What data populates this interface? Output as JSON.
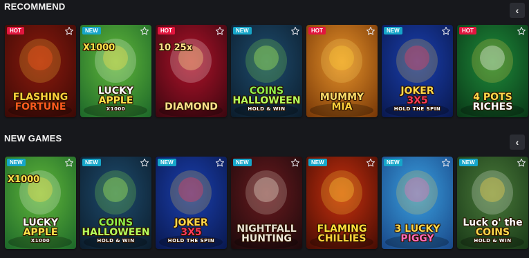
{
  "sections": [
    {
      "title": "RECOMMEND",
      "games": [
        {
          "badge": "HOT",
          "l1": "FLASHING",
          "l2": "FORTUNE",
          "l3": "",
          "extra": "",
          "bg": [
            "#8c1a0d",
            "#3d0a06"
          ],
          "c1": "#ffd23a",
          "c2": "#ff5a1e",
          "subc": "#ffffff"
        },
        {
          "badge": "NEW",
          "l1": "LUCKY",
          "l2": "APPLE",
          "l3": "X1000",
          "extra": "X1000",
          "bg": [
            "#62b83a",
            "#1f6a2a"
          ],
          "c1": "#ffffff",
          "c2": "#ffe24a",
          "subc": "#ffffff"
        },
        {
          "badge": "HOT",
          "l1": "",
          "l2": "DIAMOND",
          "l3": "",
          "extra": "10 25x",
          "bg": [
            "#b0122a",
            "#3e0710"
          ],
          "c1": "#ffffff",
          "c2": "#ffe08a",
          "subc": "#ffffff"
        },
        {
          "badge": "NEW",
          "l1": "COINS",
          "l2": "HALLOWEEN",
          "l3": "HOLD & WIN",
          "extra": "",
          "bg": [
            "#1e4c6e",
            "#0c1e2e"
          ],
          "c1": "#8ff04a",
          "c2": "#b8ff5a",
          "subc": "#ffffff"
        },
        {
          "badge": "HOT",
          "l1": "MUMMY",
          "l2": "MIA",
          "l3": "",
          "extra": "",
          "bg": [
            "#e6922a",
            "#7a3a08"
          ],
          "c1": "#ffde6a",
          "c2": "#ffcf3a",
          "subc": "#ffffff"
        },
        {
          "badge": "NEW",
          "l1": "JOKER",
          "l2": "3X5",
          "l3": "HOLD THE SPIN",
          "extra": "",
          "bg": [
            "#1a3fae",
            "#0a1a52"
          ],
          "c1": "#ffd84a",
          "c2": "#ff3a5a",
          "subc": "#ffffff"
        },
        {
          "badge": "HOT",
          "l1": "4 POTS",
          "l2": "RICHES",
          "l3": "",
          "extra": "",
          "bg": [
            "#1e8a3a",
            "#0a3a18"
          ],
          "c1": "#ffd84a",
          "c2": "#ffffff",
          "subc": "#ffffff"
        }
      ]
    },
    {
      "title": "NEW GAMES",
      "games": [
        {
          "badge": "NEW",
          "l1": "LUCKY",
          "l2": "APPLE",
          "l3": "X1000",
          "extra": "X1000",
          "bg": [
            "#62b83a",
            "#1f6a2a"
          ],
          "c1": "#ffffff",
          "c2": "#ffe24a",
          "subc": "#ffffff"
        },
        {
          "badge": "NEW",
          "l1": "COINS",
          "l2": "HALLOWEEN",
          "l3": "HOLD & WIN",
          "extra": "",
          "bg": [
            "#1e4c6e",
            "#0c1e2e"
          ],
          "c1": "#8ff04a",
          "c2": "#b8ff5a",
          "subc": "#ffffff"
        },
        {
          "badge": "NEW",
          "l1": "JOKER",
          "l2": "3X5",
          "l3": "HOLD THE SPIN",
          "extra": "",
          "bg": [
            "#1a3fae",
            "#0a1a52"
          ],
          "c1": "#ffd84a",
          "c2": "#ff3a5a",
          "subc": "#ffffff"
        },
        {
          "badge": "NEW",
          "l1": "NIGHTFALL",
          "l2": "HUNTING",
          "l3": "",
          "extra": "",
          "bg": [
            "#6a1a1e",
            "#1e0a0c"
          ],
          "c1": "#e8e0d0",
          "c2": "#f0e8d8",
          "subc": "#ffffff"
        },
        {
          "badge": "NEW",
          "l1": "FLAMING",
          "l2": "CHILLIES",
          "l3": "",
          "extra": "",
          "bg": [
            "#c8300e",
            "#4a0e04"
          ],
          "c1": "#ffe03a",
          "c2": "#ffd23a",
          "subc": "#ffffff"
        },
        {
          "badge": "NEW",
          "l1": "3 LUCKY",
          "l2": "PIGGY",
          "l3": "",
          "extra": "",
          "bg": [
            "#3aa0e0",
            "#1a4a8a"
          ],
          "c1": "#ffd84a",
          "c2": "#ff6ab8",
          "subc": "#ffffff"
        },
        {
          "badge": "NEW",
          "l1": "Luck o' the",
          "l2": "COINS",
          "l3": "HOLD & WIN",
          "extra": "",
          "bg": [
            "#4a7a3a",
            "#1a3a18"
          ],
          "c1": "#ffffff",
          "c2": "#ffd84a",
          "subc": "#ffffff"
        }
      ]
    }
  ],
  "nav": {
    "prev_label": "‹"
  }
}
